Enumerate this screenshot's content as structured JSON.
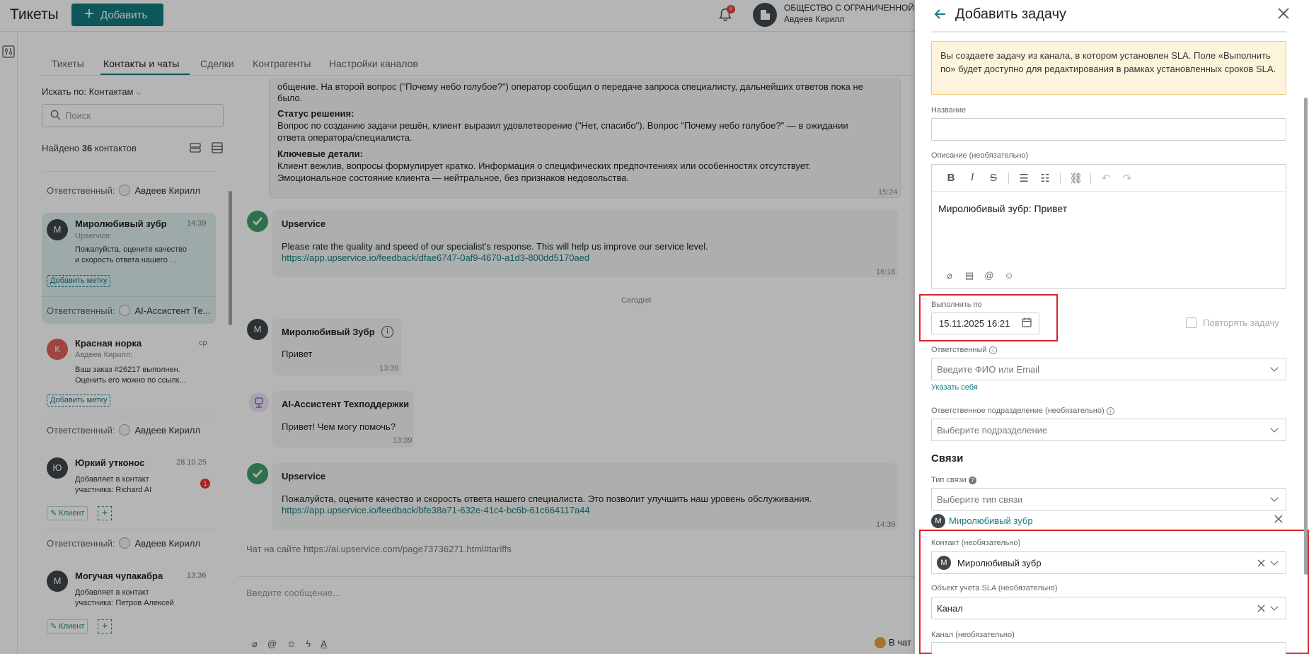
{
  "app": {
    "title": "Тикеты",
    "add_label": "Добавить",
    "notif_count": "8",
    "org": "ОБЩЕСТВО С ОГРАНИЧЕННОЙ ОТВ",
    "user": "Авдеев Кирилл"
  },
  "tabs": [
    {
      "label": "Тикеты"
    },
    {
      "label": "Контакты и чаты"
    },
    {
      "label": "Сделки"
    },
    {
      "label": "Контрагенты"
    },
    {
      "label": "Настройки каналов"
    }
  ],
  "contacts": {
    "search_by": "Искать по: Контактам",
    "search_placeholder": "Поиск",
    "found_prefix": "Найдено ",
    "found_count": "36",
    "found_suffix": " контактов",
    "resp_label": "Ответственный:",
    "items": [
      {
        "initial": "М",
        "name": "Миролюбивый зубр",
        "time": "14:39",
        "channel": "Upservice:",
        "line1": "Пожалуйста, оцените качество",
        "line2": "и скорость ответа нашего ...",
        "tag": "Добавить метку",
        "resp": "AI-Ассистент Те...",
        "color": "#3f4548"
      },
      {
        "initial": "К",
        "name": "Красная норка",
        "time": "ср",
        "channel": "Авдеев Кирилл:",
        "line1": "Ваш заказ #26217 выполнен.",
        "line2": "Оценить его можно по ссылк...",
        "tag": "Добавить метку",
        "resp": "Авдеев Кирилл",
        "color": "#e06058"
      },
      {
        "initial": "Ю",
        "name": "Юркий утконос",
        "time": "28.10.25",
        "line1": "Добавляет в контакт",
        "line2": "участника: Richard AI",
        "client": "Клиент",
        "resp": "Авдеев Кирилл",
        "unread": "1",
        "color": "#3f4548"
      },
      {
        "initial": "М",
        "name": "Могучая чупакабра",
        "time": "13:36",
        "line1": "Добавляет в контакт",
        "line2": "участника: Петров Алексей",
        "client": "Клиент",
        "color": "#3f4548"
      }
    ],
    "top_resp": "Авдеев Кирилл"
  },
  "chat": {
    "summary": {
      "line0": "общение. На второй вопрос (\"Почему небо голубое?\") оператор сообщил о передаче запроса специалисту, дальнейших ответов пока не",
      "line0b": "было.",
      "h1": "Статус решения:",
      "t1a": "Вопрос по созданию задачи решён, клиент выразил удовлетворение (\"Нет, спасибо\"). Вопрос \"Почему небо голубое?\" — в ожидании",
      "t1b": "ответа оператора/специалиста.",
      "h2": "Ключевые детали:",
      "t2a": "Клиент вежлив, вопросы формулирует кратко. Информация о специфических предпочтениях или особенностях отсутствует.",
      "t2b": "Эмоциональное состояние клиента — нейтральное, без признаков недовольства.",
      "time": "15:24"
    },
    "m1": {
      "name": "Upservice",
      "text": "Please rate the quality and speed of our specialist's response. This will help us improve our service level.",
      "link": "https://app.upservice.io/feedback/dfae6747-0af9-4670-a1d3-800dd5170aed",
      "time": "16:18"
    },
    "today": "Сегодня",
    "m2": {
      "initial": "М",
      "name": "Миролюбивый Зубр",
      "text": "Привет",
      "time": "13:39"
    },
    "m3": {
      "name": "AI-Ассистент Техподдержки",
      "text": "Привет! Чем могу помочь?",
      "time": "13:39"
    },
    "m4": {
      "name": "Upservice",
      "text": "Пожалуйста, оцените качество и скорость ответа нашего специалиста. Это позволит улучшить наш уровень обслуживания.",
      "link": "https://app.upservice.io/feedback/bfe38a71-632e-41c4-bc6b-61c664117a44",
      "time": "14:39"
    },
    "footer": "Чат на сайте https://ai.upservice.com/page73736271.html#tariffs",
    "composer_placeholder": "Введите сообщение...",
    "to_chat": "В чат"
  },
  "panel": {
    "title": "Добавить задачу",
    "sla_note": "Вы создаете задачу из канала, в котором установлен SLA. Поле «Выполнить по» будет доступно для редактирования в рамках установленных сроков SLA.",
    "name_label": "Название",
    "desc_label": "Описание (необязательно)",
    "desc_value": "Миролюбивый зубр: Привет",
    "due_label": "Выполнить по",
    "due_value": "15.11.2025 16:21",
    "repeat_label": "Повторять задачу",
    "resp_label": "Ответственный",
    "resp_placeholder": "Введите ФИО или Email",
    "assign_self": "Указать себя",
    "dept_label": "Ответственное подразделение (необязательно)",
    "dept_placeholder": "Выберите подразделение",
    "links_title": "Связи",
    "link_type_label": "Тип связи",
    "link_type_placeholder": "Выберите тип связи",
    "linked_contact": "Миролюбивый зубр",
    "linked_initial": "М",
    "contact_label": "Контакт (необязательно)",
    "contact_value": "Миролюбивый зубр",
    "sla_obj_label": "Объект учета SLA (необязательно)",
    "sla_obj_value": "Канал",
    "channel_label": "Канал (необязательно)"
  }
}
